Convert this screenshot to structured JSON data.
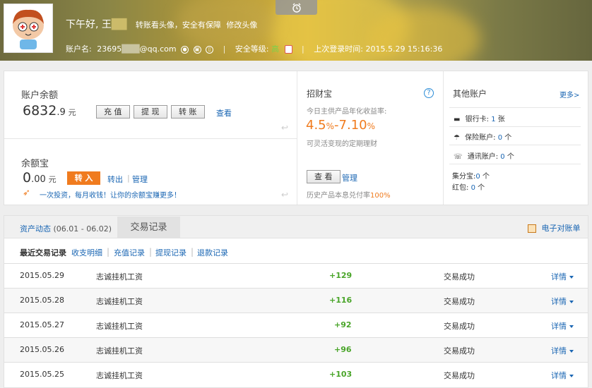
{
  "header": {
    "greeting": "下午好, 王",
    "masked_name": "██",
    "avatar_link": "转账看头像，安全有保障",
    "edit_avatar": "修改头像",
    "account_label": "账户名:",
    "account_prefix": "23695",
    "account_masked": "███",
    "account_suffix": "@qq.com",
    "security_label": "安全等级:",
    "security_level": "高",
    "last_login_label": "上次登录时间:",
    "last_login_time": "2015.5.29 15:16:36"
  },
  "balance": {
    "title": "账户余额",
    "amount_int": "6832",
    "amount_dec": ".9",
    "unit": "元",
    "recharge": "充 值",
    "withdraw": "提 现",
    "transfer": "转 账",
    "view": "查看"
  },
  "yuebao": {
    "title": "余额宝",
    "amount_int": "0",
    "amount_dec": ".00",
    "unit": "元",
    "transfer_in": "转 入",
    "transfer_out": "转出",
    "manage": "管理",
    "promo": "一次投资，每月收钱！让你的余额宝赚更多！"
  },
  "zhaocaibao": {
    "title": "招财宝",
    "yield_label": "今日主供产品年化收益率:",
    "yield_low": "4.5",
    "yield_high": "-7.10",
    "pct": "%",
    "desc": "可灵活变现的定期理财",
    "view": "查 看",
    "manage": "管理",
    "history_label": "历史产品本息兑付率",
    "history_rate": "100%"
  },
  "other": {
    "title": "其他账户",
    "more": "更多>",
    "bank_label": "银行卡:",
    "bank_count": "1",
    "bank_unit": "张",
    "insurance_label": "保险账户:",
    "insurance_count": "0",
    "insurance_unit": "个",
    "comm_label": "通讯账户:",
    "comm_count": "0",
    "comm_unit": "个",
    "jifen_label": "集分宝:",
    "jifen_count": "0",
    "jifen_unit": "个",
    "redpack_label": "红包:",
    "redpack_count": "0",
    "redpack_unit": "个"
  },
  "tabs": {
    "assets": "资产动态",
    "assets_range": "(06.01 - 06.02)",
    "records": "交易记录",
    "statement": "电子对账单"
  },
  "filters": {
    "recent": "最近交易记录",
    "items": [
      "收支明细",
      "充值记录",
      "提现记录",
      "退款记录"
    ]
  },
  "transactions": [
    {
      "date": "2015.05.29",
      "name": "志诚挂机工资",
      "amount": "+129",
      "status": "交易成功",
      "detail": "详情"
    },
    {
      "date": "2015.05.28",
      "name": "志诚挂机工资",
      "amount": "+116",
      "status": "交易成功",
      "detail": "详情"
    },
    {
      "date": "2015.05.27",
      "name": "志诚挂机工资",
      "amount": "+92",
      "status": "交易成功",
      "detail": "详情"
    },
    {
      "date": "2015.05.26",
      "name": "志诚挂机工资",
      "amount": "+96",
      "status": "交易成功",
      "detail": "详情"
    },
    {
      "date": "2015.05.25",
      "name": "志诚挂机工资",
      "amount": "+103",
      "status": "交易成功",
      "detail": "详情"
    }
  ],
  "colors": {
    "accent_orange": "#f07b1e",
    "link_blue": "#1a66b3",
    "positive_green": "#4aa52a"
  }
}
